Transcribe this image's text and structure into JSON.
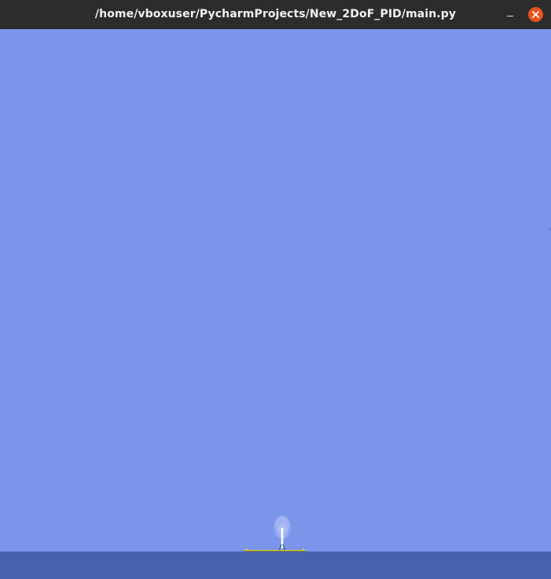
{
  "window": {
    "title": "/home/vboxuser/PycharmProjects/New_2DoF_PID/main.py",
    "controls": {
      "minimize_icon": "minimize-icon",
      "close_icon": "close-icon"
    }
  },
  "simulation": {
    "sky_color": "#7b95eb",
    "ground_color": "#4661ae",
    "landing_pad_color": "#d4cc3c",
    "rocket_color": "#ffffff",
    "exhaust_color": "#a9b9f1"
  },
  "colors": {
    "titlebar": "#2c2c2c",
    "title_text": "#f2f2f2",
    "close_accent": "#e95420"
  }
}
